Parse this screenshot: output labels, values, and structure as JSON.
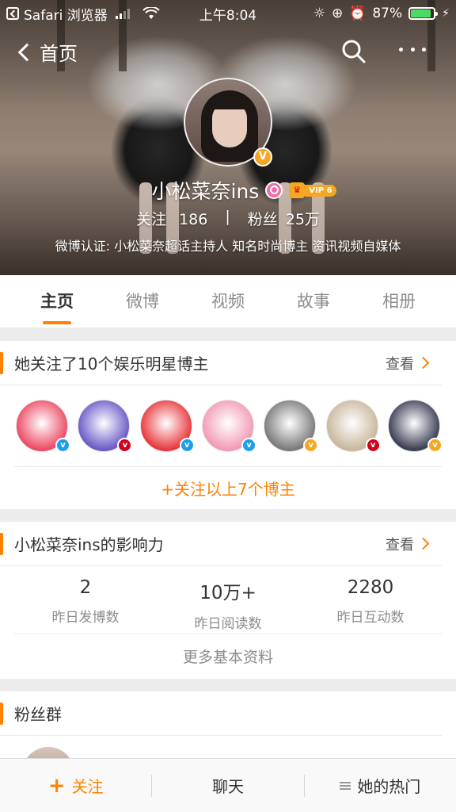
{
  "status_bar": {
    "app": "Safari 浏览器",
    "time": "上午8:04",
    "battery": "87%",
    "battery_level": 0.87
  },
  "nav": {
    "back_label": "首页",
    "search_icon": "search-icon",
    "more_icon": "more-dots-icon"
  },
  "profile": {
    "name": "小松菜奈ins",
    "vip_label": "VIP 6",
    "following_label": "关注",
    "following_count": "186",
    "separator": "|",
    "fans_label": "粉丝",
    "fans_count": "25万",
    "verification": "微博认证: 小松菜奈超话主持人 知名时尚博主 资讯视频自媒体",
    "verified_badge": "V"
  },
  "tabs": [
    {
      "label": "主页",
      "active": true
    },
    {
      "label": "微博",
      "active": false
    },
    {
      "label": "视频",
      "active": false
    },
    {
      "label": "故事",
      "active": false
    },
    {
      "label": "相册",
      "active": false
    }
  ],
  "following_card": {
    "title": "她关注了10个娱乐明星博主",
    "more": "查看",
    "avatars": [
      {
        "name": "sina-entertainment",
        "badge": "blue",
        "color": "#ec4b64"
      },
      {
        "name": "yuzu-logo",
        "badge": "red",
        "color": "#6a5ac8"
      },
      {
        "name": "red-diamond-logo",
        "badge": "blue",
        "color": "#e8383d"
      },
      {
        "name": "xinlang-star",
        "badge": "blue",
        "color": "#f29bb3"
      },
      {
        "name": "man-portrait",
        "badge": "orange",
        "color": "#7a7a7a"
      },
      {
        "name": "panda-mask",
        "badge": "red",
        "color": "#c9b79c"
      },
      {
        "name": "avengers-logo",
        "badge": "orange",
        "color": "#3b3f55"
      }
    ],
    "follow_all": "+关注以上7个博主"
  },
  "influence_card": {
    "title": "小松菜奈ins的影响力",
    "more": "查看",
    "items": [
      {
        "value": "2",
        "label": "昨日发博数"
      },
      {
        "value": "10万+",
        "label": "昨日阅读数"
      },
      {
        "value": "2280",
        "label": "昨日互动数"
      }
    ],
    "more_info": "更多基本资料"
  },
  "fans_card": {
    "title": "粉丝群"
  },
  "bottom_bar": {
    "follow": "关注",
    "chat": "聊天",
    "hot": "她的热门"
  },
  "colors": {
    "accent": "#ff8200",
    "verified_gold": "#f5a623",
    "verified_blue": "#1e9dea",
    "verified_red": "#d0021b"
  }
}
